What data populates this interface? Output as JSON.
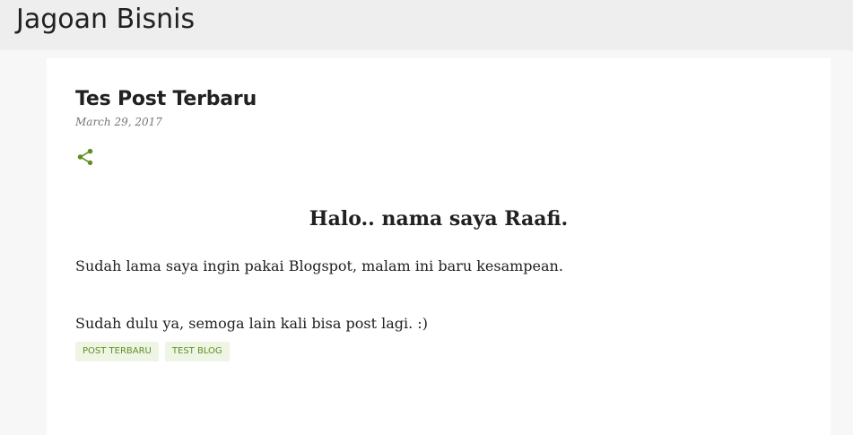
{
  "header": {
    "blog_title": "Jagoan Bisnis"
  },
  "post": {
    "title": "Tes Post Terbaru",
    "date": "March 29, 2017",
    "share_icon": "share-icon",
    "heading": "Halo.. nama saya Raafi.",
    "paragraphs": [
      "Sudah lama saya ingin pakai Blogspot, malam ini baru kesampean.",
      "Sudah dulu ya, semoga lain kali bisa post lagi. :)"
    ],
    "labels": [
      "POST TERBARU",
      "TEST BLOG"
    ]
  },
  "colors": {
    "accent": "#5f8f1f",
    "label_bg": "#eef5e5",
    "header_bg": "#eeeeee",
    "page_bg": "#f7f7f7"
  }
}
